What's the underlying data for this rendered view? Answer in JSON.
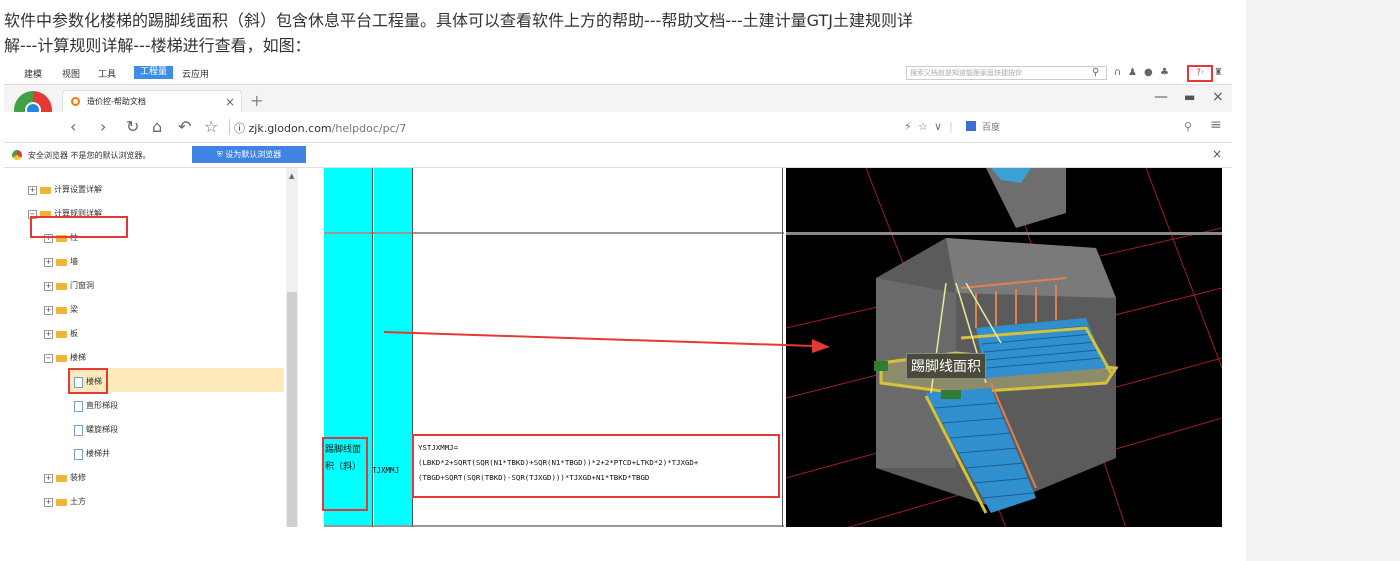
{
  "article": {
    "line1": "软件中参数化楼梯的踢脚线面积（斜）包含休息平台工程量。具体可以查看软件上方的帮助---帮助文档---土建计量GTJ土建规则详",
    "line2": "解---计算规则详解---楼梯进行查看，如图："
  },
  "app": {
    "menus": [
      "建模",
      "视图",
      "工具",
      "工程量",
      "云应用"
    ],
    "active_menu_index": 3,
    "search_placeholder": "搜索又档就是知道能跟家庭快捷按你",
    "help_label": "?·"
  },
  "browser": {
    "tab_title": "造价控-帮助文档",
    "url_domain": "zjk.glodon.com",
    "url_path": "/helpdoc/pc/7",
    "search_engine": "百度",
    "info_message": "安全浏览器 不是您的默认浏览器。",
    "set_default_label": "设为默认浏览器"
  },
  "tree": {
    "nodes": [
      {
        "label": "计算设置详解",
        "level": 1,
        "expander": "+"
      },
      {
        "label": "计算规则详解",
        "level": 1,
        "expander": "−"
      },
      {
        "label": "柱",
        "level": 2,
        "expander": "+"
      },
      {
        "label": "墙",
        "level": 2,
        "expander": "+"
      },
      {
        "label": "门窗洞",
        "level": 2,
        "expander": "+"
      },
      {
        "label": "梁",
        "level": 2,
        "expander": "+"
      },
      {
        "label": "板",
        "level": 2,
        "expander": "+"
      },
      {
        "label": "楼梯",
        "level": 2,
        "expander": "−"
      },
      {
        "label": "楼梯",
        "level": 3,
        "expander": ""
      },
      {
        "label": "直形梯段",
        "level": 3,
        "expander": ""
      },
      {
        "label": "螺旋梯段",
        "level": 3,
        "expander": ""
      },
      {
        "label": "楼梯井",
        "level": 3,
        "expander": ""
      },
      {
        "label": "装修",
        "level": 2,
        "expander": "+"
      },
      {
        "label": "土方",
        "level": 2,
        "expander": "+"
      }
    ]
  },
  "table": {
    "name": "踢脚线面积（斜）",
    "code": "TJXMMJ",
    "formula_lines": [
      "YSTJXMMJ=",
      "(LBKD*2+SQRT(SQR(N1*TBKD)+SQR(N1*TBGD))*2+2*PTCD+LTKD*2)*TJXGD+",
      "(TBGD+SQRT(SQR(TBKD)-SQR(TJXGD)))*TJXGD+N1*TBKD*TBGD"
    ]
  },
  "view3d": {
    "callout": "踢脚线面积"
  },
  "colors": {
    "cyan_column": "#00ffff",
    "highlight_red": "#e53935",
    "folder": "#f1b433",
    "accent_blue": "#3d8ee6"
  }
}
